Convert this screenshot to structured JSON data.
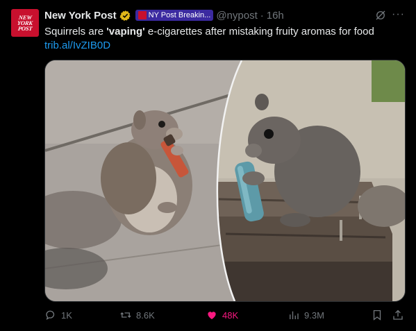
{
  "post": {
    "avatar_lines": [
      "NEW",
      "YORK",
      "POST"
    ],
    "author_name": "New York Post",
    "affiliate_label": "NY Post Breakin...",
    "handle": "@nypost",
    "separator": "·",
    "time_ago": "16h",
    "text_before": "Squirrels are ",
    "text_bold": "'vaping'",
    "text_after": " e-cigarettes after mistaking fruity aromas for food",
    "link": "trib.al/IvZIB0D"
  },
  "media": {
    "left_image": "squirrel holding a red and brown e-cigarette on pavement",
    "right_image": "gray squirrel holding a teal vape on a wooden stump"
  },
  "actions": {
    "reply_count": "1K",
    "repost_count": "8.6K",
    "like_count": "48K",
    "views_count": "9.3M"
  },
  "icons": {
    "verified": "verified-badge-icon",
    "grok": "grok-icon",
    "more": "more-icon",
    "reply": "reply-icon",
    "repost": "repost-icon",
    "like": "heart-icon",
    "views": "views-icon",
    "bookmark": "bookmark-icon",
    "share": "share-icon"
  },
  "colors": {
    "background": "#000000",
    "text": "#e7e9ea",
    "muted": "#71767b",
    "link": "#1d9bf0",
    "like": "#f91880",
    "verified": "#e2b719",
    "affiliate_badge": "#3b2aa0",
    "brand": "#c8102e"
  }
}
